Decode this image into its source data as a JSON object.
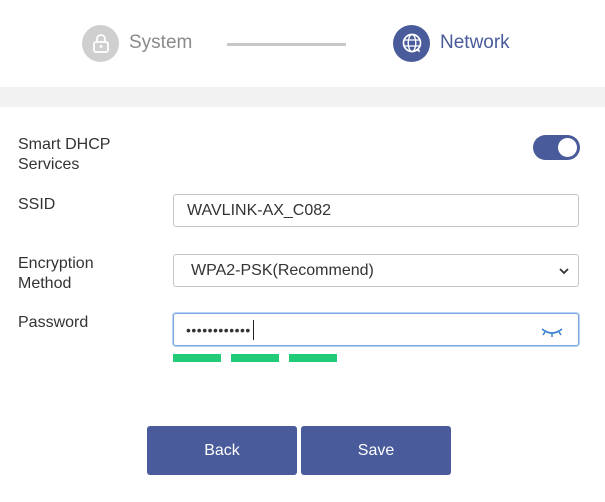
{
  "stepper": {
    "steps": [
      {
        "label": "System",
        "icon": "lock-icon",
        "state": "completed"
      },
      {
        "label": "Network",
        "icon": "globe-icon",
        "state": "active"
      }
    ],
    "active_color": "#4a5b9b",
    "inactive_color": "#cfcfcf"
  },
  "form": {
    "dhcp": {
      "label": "Smart DHCP\nServices",
      "enabled": true
    },
    "ssid": {
      "label": "SSID",
      "value": "WAVLINK-AX_C082"
    },
    "encryption": {
      "label": "Encryption\nMethod",
      "value": "WPA2-PSK(Recommend)"
    },
    "password": {
      "label": "Password",
      "masked_value": "••••••••••••",
      "strength_bars": 3,
      "strength_color": "#22cc77"
    }
  },
  "buttons": {
    "back": "Back",
    "save": "Save"
  }
}
